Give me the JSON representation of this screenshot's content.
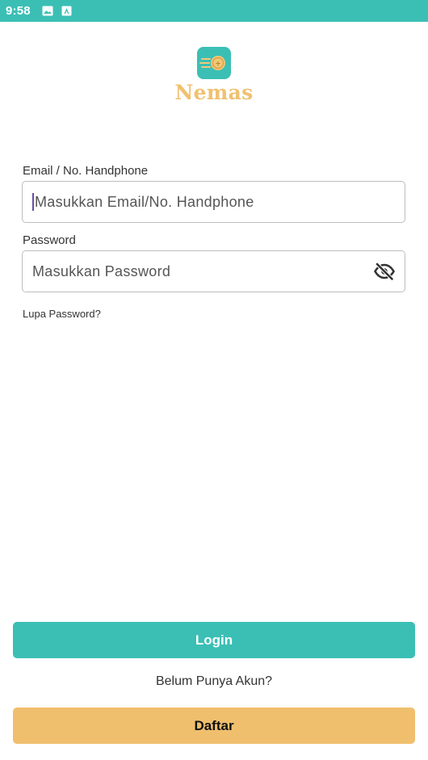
{
  "status_bar": {
    "time": "9:58",
    "icons": [
      "image-icon",
      "app-notification-icon"
    ],
    "background": "#3bbfb5"
  },
  "brand": {
    "name": "Nemas",
    "icon": "coin-icon",
    "name_color": "#f0c170",
    "icon_background": "#3bbfb5"
  },
  "form": {
    "email": {
      "label": "Email / No. Handphone",
      "placeholder": "Masukkan Email/No. Handphone",
      "value": ""
    },
    "password": {
      "label": "Password",
      "placeholder": "Masukkan Password",
      "value": "",
      "toggle_icon": "eye-off-icon"
    },
    "forgot_password": "Lupa Password?"
  },
  "actions": {
    "login_label": "Login",
    "no_account_text": "Belum Punya Akun?",
    "register_label": "Daftar",
    "login_color": "#3bbfb5",
    "register_color": "#f0bf6e"
  }
}
